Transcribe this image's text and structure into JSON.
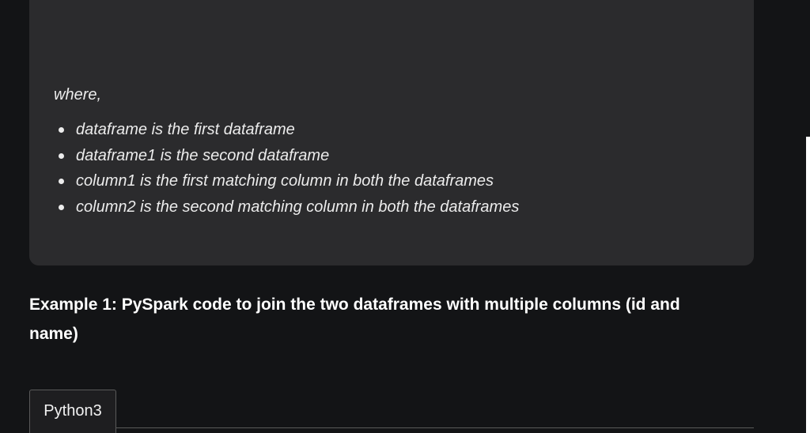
{
  "note": {
    "intro": "where,",
    "items": [
      "dataframe is the first dataframe",
      "dataframe1 is the second dataframe",
      "column1 is the first matching column in both the dataframes",
      "column2 is the second matching column in both the dataframes"
    ]
  },
  "example": {
    "heading": "Example 1: PySpark code to join the two dataframes with multiple columns (id and name)"
  },
  "code": {
    "tab_label": "Python3"
  }
}
